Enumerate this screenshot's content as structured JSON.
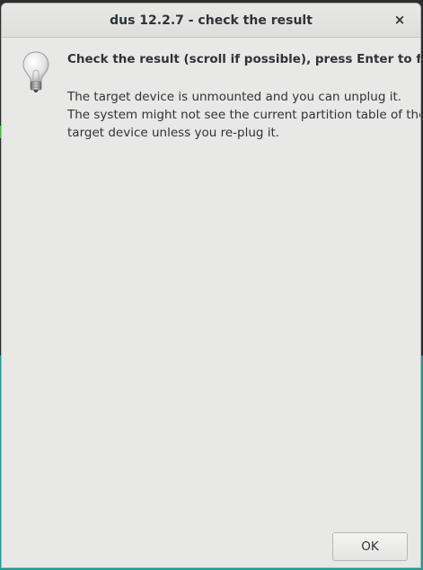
{
  "window": {
    "title": "dus 12.2.7 - check the result",
    "close_glyph": "×"
  },
  "dialog": {
    "icon": "lightbulb-icon",
    "heading": "Check the result (scroll if possible), press Enter to finish",
    "message_lines": [
      "The target device is unmounted and you can unplug it.",
      "The system might not see the current partition table of the",
      "target device unless you re-plug it."
    ]
  },
  "buttons": {
    "ok_label": "OK"
  },
  "colors": {
    "dialog_bg": "#e8e8e7",
    "text": "#2e3436",
    "desktop_teal": "#1f9b93",
    "desktop_dark": "#2d2d2d"
  }
}
